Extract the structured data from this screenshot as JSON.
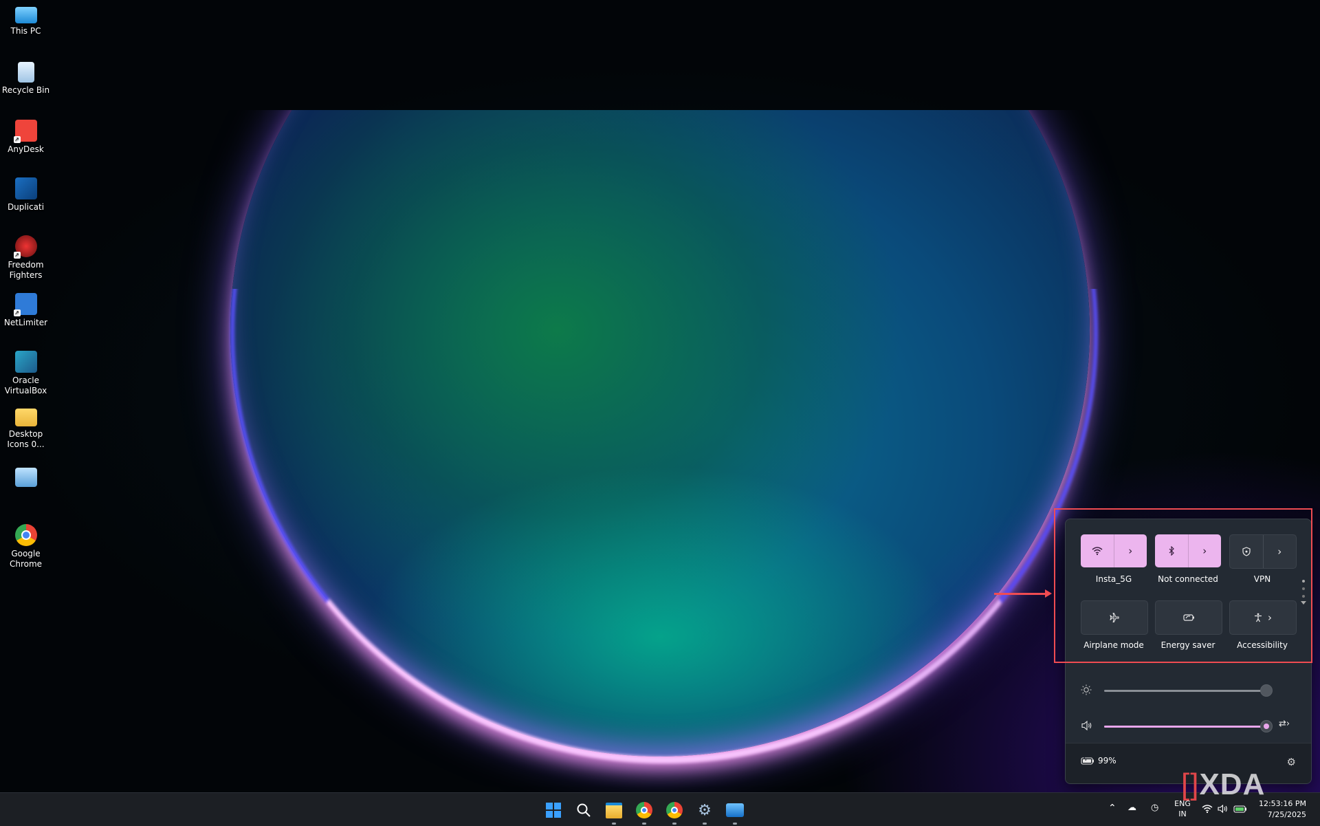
{
  "desktop_icons": [
    {
      "label": "This PC",
      "icon": "monitor-icon"
    },
    {
      "label": "Recycle Bin",
      "icon": "recycle-bin-icon"
    },
    {
      "label": "AnyDesk",
      "icon": "anydesk-icon"
    },
    {
      "label": "Duplicati",
      "icon": "duplicati-icon"
    },
    {
      "label": "Freedom Fighters",
      "icon": "freedom-fighters-icon"
    },
    {
      "label": "NetLimiter",
      "icon": "netlimiter-icon"
    },
    {
      "label": "Oracle VirtualBox",
      "icon": "virtualbox-icon"
    },
    {
      "label": "Desktop Icons 0...",
      "icon": "folder-icon"
    },
    {
      "label": "",
      "icon": "presentation-icon"
    },
    {
      "label": "Google Chrome",
      "icon": "chrome-icon"
    }
  ],
  "quick_settings": {
    "tiles": [
      {
        "label": "Insta_5G",
        "icon": "wifi-icon",
        "state": "on",
        "has_arrow": true
      },
      {
        "label": "Not connected",
        "icon": "bluetooth-icon",
        "state": "on",
        "has_arrow": true
      },
      {
        "label": "VPN",
        "icon": "shield-icon",
        "state": "off",
        "has_arrow": true
      },
      {
        "label": "Airplane mode",
        "icon": "airplane-icon",
        "state": "off",
        "has_arrow": false
      },
      {
        "label": "Energy saver",
        "icon": "energy-saver-icon",
        "state": "off",
        "has_arrow": false
      },
      {
        "label": "Accessibility",
        "icon": "accessibility-icon",
        "state": "off",
        "has_arrow": true
      }
    ],
    "brightness": {
      "icon": "brightness-icon",
      "level": 1.0
    },
    "volume": {
      "icon": "speaker-icon",
      "level": 1.0
    },
    "battery_label": "99%"
  },
  "taskbar": {
    "apps": [
      "start-icon",
      "search-icon",
      "file-explorer-icon",
      "chrome-icon",
      "chrome-profile-icon",
      "settings-icon",
      "photos-icon"
    ],
    "language_line1": "ENG",
    "language_line2": "IN",
    "time": "12:53:16 PM",
    "date": "7/25/2025"
  },
  "watermark": "XDA",
  "colors": {
    "accent": "#ecb5ee",
    "highlight": "#f04c52"
  }
}
